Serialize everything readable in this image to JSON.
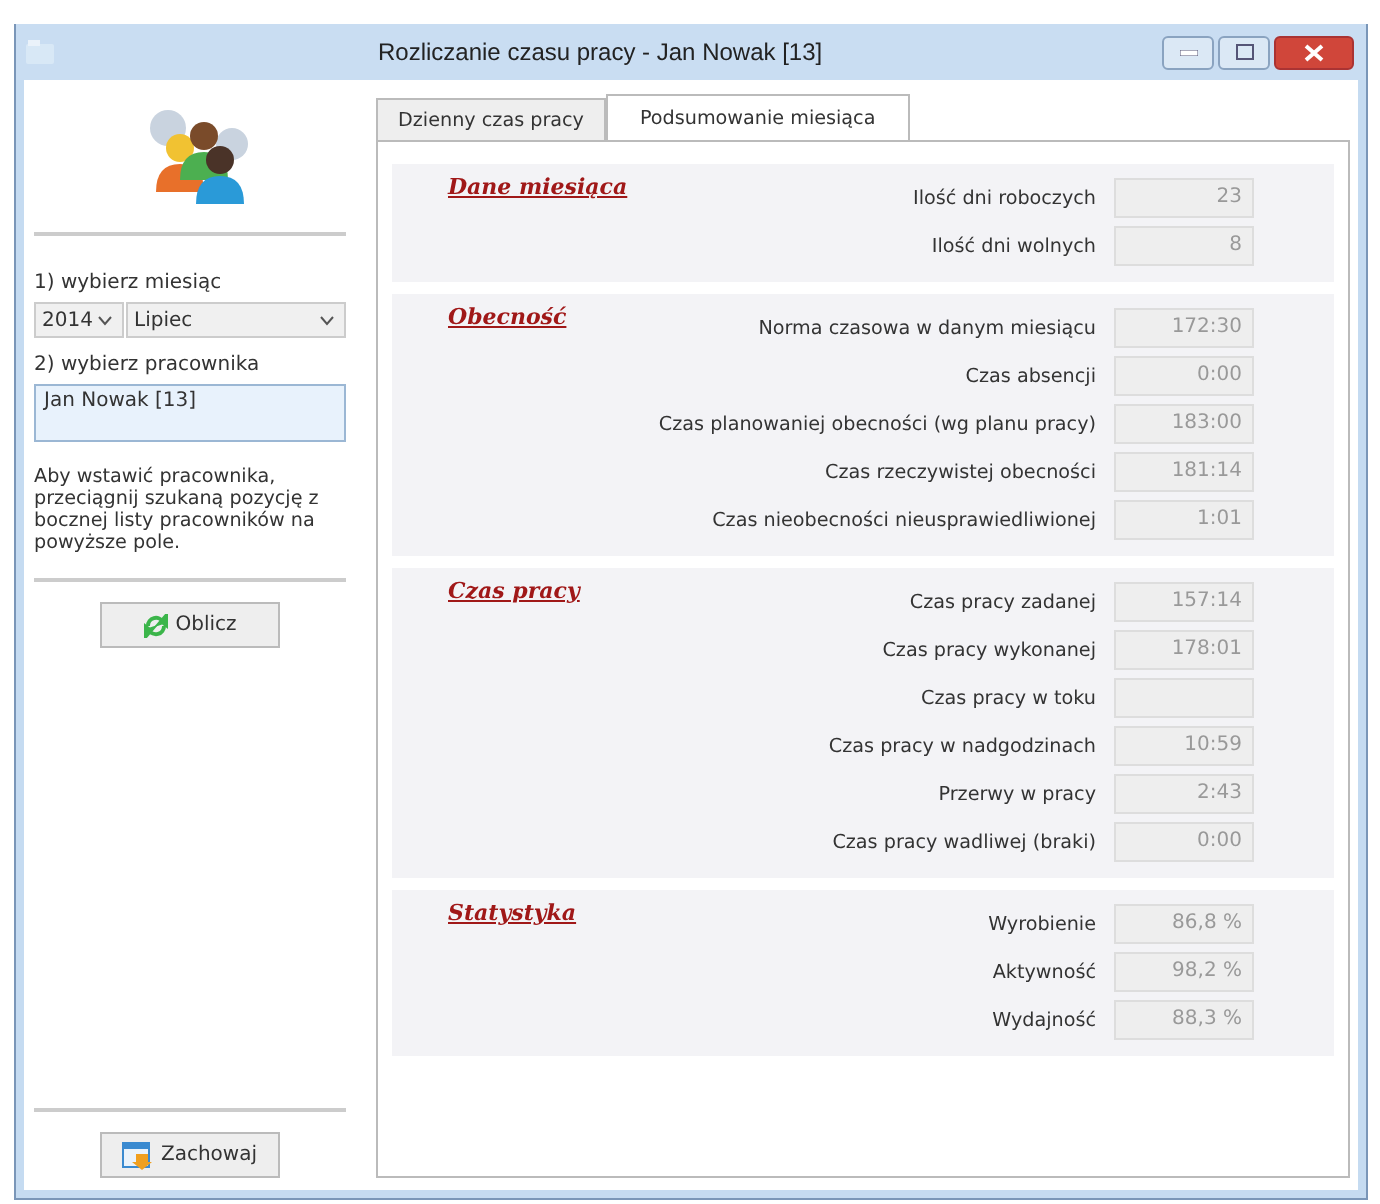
{
  "window": {
    "title": "Rozliczanie czasu pracy - Jan Nowak [13]"
  },
  "sidebar": {
    "month_label": "1) wybierz miesiąc",
    "year": "2014",
    "month": "Lipiec",
    "employee_label": "2) wybierz pracownika",
    "employee": "Jan Nowak [13]",
    "hint": "Aby wstawić pracownika, przeciągnij szukaną pozycję z bocznej listy pracowników na powyższe pole.",
    "calculate_button": "Oblicz",
    "save_button": "Zachowaj"
  },
  "tabs": [
    {
      "label": "Dzienny czas pracy",
      "selected": false
    },
    {
      "label": "Podsumowanie miesiąca",
      "selected": true
    }
  ],
  "sections": [
    {
      "title": "Dane miesiąca",
      "rows": [
        {
          "label": "Ilość dni roboczych",
          "value": "23"
        },
        {
          "label": "Ilość dni wolnych",
          "value": "8"
        }
      ]
    },
    {
      "title": "Obecność",
      "rows": [
        {
          "label": "Norma czasowa w danym miesiącu",
          "value": "172:30"
        },
        {
          "label": "Czas absencji",
          "value": "0:00"
        },
        {
          "label": "Czas planowaniej obecności (wg planu pracy)",
          "value": "183:00"
        },
        {
          "label": "Czas rzeczywistej obecności",
          "value": "181:14"
        },
        {
          "label": "Czas nieobecności nieusprawiedliwionej",
          "value": "1:01"
        }
      ]
    },
    {
      "title": "Czas pracy",
      "rows": [
        {
          "label": "Czas pracy zadanej",
          "value": "157:14"
        },
        {
          "label": "Czas pracy wykonanej",
          "value": "178:01"
        },
        {
          "label": "Czas pracy w toku"
        },
        {
          "label": "Czas pracy w nadgodzinach",
          "value": "10:59"
        },
        {
          "label": "Przerwy w pracy",
          "value": "2:43"
        },
        {
          "label": "Czas pracy wadliwej (braki)",
          "value": "0:00"
        }
      ]
    },
    {
      "title": "Statystyka",
      "rows": [
        {
          "label": "Wyrobienie",
          "value": "86,8 %"
        },
        {
          "label": "Aktywność",
          "value": "98,2 %"
        },
        {
          "label": "Wydajność",
          "value": "88,3 %"
        }
      ]
    }
  ]
}
